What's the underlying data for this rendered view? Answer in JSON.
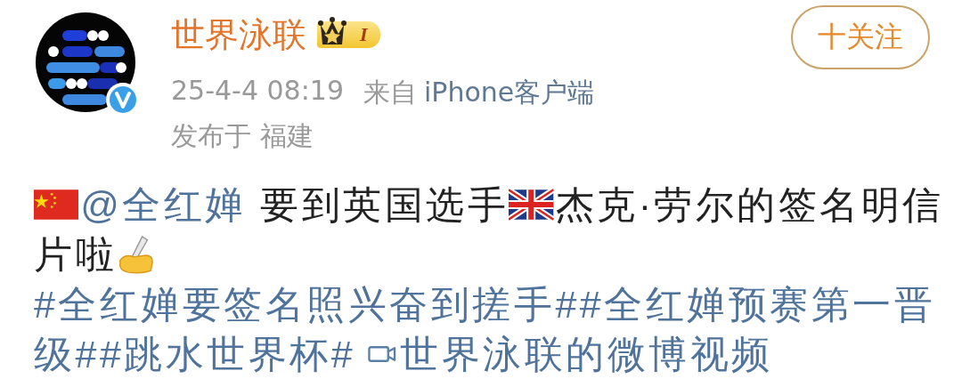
{
  "author": {
    "name": "世界泳联",
    "level_badge": "I",
    "verified": true
  },
  "follow_button": {
    "label": "十关注"
  },
  "meta": {
    "time": "25-4-4 08:19",
    "source_prefix": "来自",
    "source": "iPhone客户端",
    "location": "发布于 福建"
  },
  "content_lines": [
    [
      {
        "kind": "mention",
        "text": "@全红婵"
      },
      {
        "kind": "text",
        "text": " 要到英国选手"
      },
      {
        "kind": "text",
        "text": "杰克·劳尔的签名明信"
      }
    ],
    [
      {
        "kind": "text",
        "text": "片啦"
      }
    ],
    [
      {
        "kind": "hashtag",
        "text": "#全红婵要签名照兴奋到搓手#"
      },
      {
        "kind": "hashtag",
        "text": "#全红婵预赛第一晋"
      }
    ],
    [
      {
        "kind": "hashtag",
        "text": "级#"
      },
      {
        "kind": "hashtag",
        "text": "#跳水世界杯#"
      },
      {
        "kind": "video",
        "text": "世界泳联的微博视频"
      }
    ]
  ]
}
